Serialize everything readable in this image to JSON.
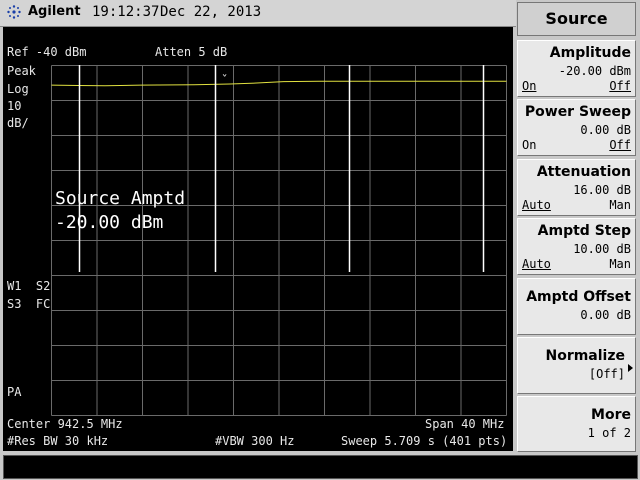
{
  "header": {
    "brand": "Agilent",
    "time": "19:12:37",
    "date": "Dec 22, 2013"
  },
  "screen": {
    "ref_level": "Ref -40 dBm",
    "attenuation": "Atten 5 dB",
    "left_labels": [
      "Peak",
      "Log",
      "10",
      "dB/"
    ],
    "trace_labels_1": "W1  S2",
    "trace_labels_2": "S3  FC",
    "pa_label": "PA",
    "marker_symbol": "ˇ",
    "annotation_line1": "Source Amptd",
    "annotation_line2": "-20.00 dBm",
    "center_freq": "Center 942.5 MHz",
    "span": "Span 40 MHz",
    "res_bw": "#Res BW 30 kHz",
    "vbw": "#VBW 300 Hz",
    "sweep": "Sweep 5.709 s (401 pts)",
    "colors": {
      "background": "#000000",
      "grid": "#6a6a6a",
      "trace": "#e0e040",
      "spur": "#ffffff"
    },
    "trace": {
      "x": [
        0,
        30,
        60,
        100,
        160,
        200,
        230,
        260,
        300,
        350,
        400,
        460,
        510
      ],
      "y": [
        -45.6,
        -45.7,
        -45.8,
        -45.6,
        -45.5,
        -45.3,
        -45.0,
        -44.6,
        -44.5,
        -44.5,
        -44.5,
        -44.5,
        -44.5
      ]
    }
  },
  "softkeys": {
    "title": "Source",
    "keys": [
      {
        "label": "Amplitude",
        "value": "-20.00 dBm",
        "left": "On",
        "right": "Off"
      },
      {
        "label": "Power Sweep",
        "value": "0.00 dB",
        "left": "On",
        "right": "Off"
      },
      {
        "label": "Attenuation",
        "value": "16.00 dB",
        "left": "Auto",
        "right": "Man"
      },
      {
        "label": "Amptd Step",
        "value": "10.00 dB",
        "left": "Auto",
        "right": "Man"
      },
      {
        "label": "Amptd Offset",
        "value": "0.00 dB"
      },
      {
        "label": "Normalize",
        "value": "[Off]"
      },
      {
        "label": "More",
        "value": "1 of 2"
      }
    ]
  }
}
